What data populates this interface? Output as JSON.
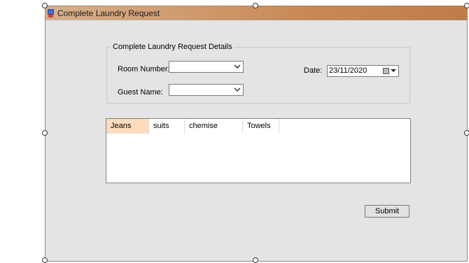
{
  "window": {
    "title": "Complete Laundry Request",
    "icon": "app-form-icon"
  },
  "details_group": {
    "legend": "Complete Laundry Request Details",
    "room_number_label": "Room Number:",
    "room_number_value": "",
    "guest_name_label": "Guest Name:",
    "guest_name_value": "",
    "date_label": "Date:",
    "date_value": "23/11/2020"
  },
  "items_list": {
    "columns": [
      "Jeans",
      "suits",
      "chemise",
      "Towels"
    ],
    "active_column": "Jeans",
    "rows": []
  },
  "actions": {
    "submit_label": "Submit"
  },
  "colors": {
    "titlebar_start": "#d7b08a",
    "titlebar_end": "#c07c48",
    "form_background": "#e4e4e4",
    "active_column_header": "#fbdcbd"
  }
}
